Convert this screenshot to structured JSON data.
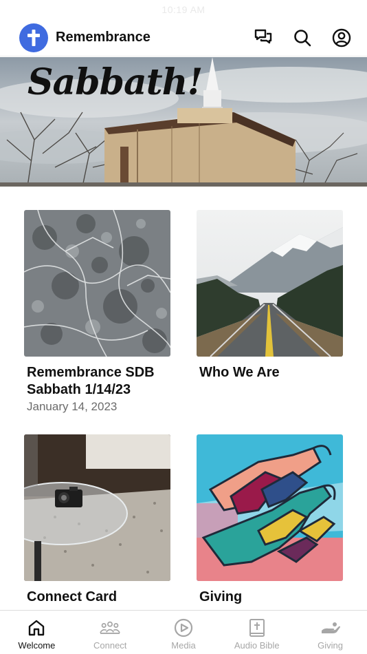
{
  "status_bar": {
    "time": "10:19 AM"
  },
  "header": {
    "title": "Remembrance",
    "icons": [
      "cross-logo-icon",
      "chat-icon",
      "search-icon",
      "account-icon"
    ],
    "accent_color": "#3f6be0"
  },
  "banner": {
    "text": "Sabbath!"
  },
  "cards": [
    {
      "title": "Remembrance SDB Sabbath 1/14/23",
      "subtitle": "January 14, 2023"
    },
    {
      "title": "Who We Are",
      "subtitle": ""
    },
    {
      "title": "Connect Card",
      "subtitle": ""
    },
    {
      "title": "Giving",
      "subtitle": ""
    }
  ],
  "tabbar": {
    "active_color": "#111111",
    "inactive_color": "#a6a6a6",
    "tabs": [
      {
        "label": "Welcome",
        "icon": "home-icon",
        "active": true
      },
      {
        "label": "Connect",
        "icon": "people-icon",
        "active": false
      },
      {
        "label": "Media",
        "icon": "play-icon",
        "active": false
      },
      {
        "label": "Audio Bible",
        "icon": "bible-icon",
        "active": false
      },
      {
        "label": "Giving",
        "icon": "giving-hand-icon",
        "active": false
      }
    ]
  }
}
